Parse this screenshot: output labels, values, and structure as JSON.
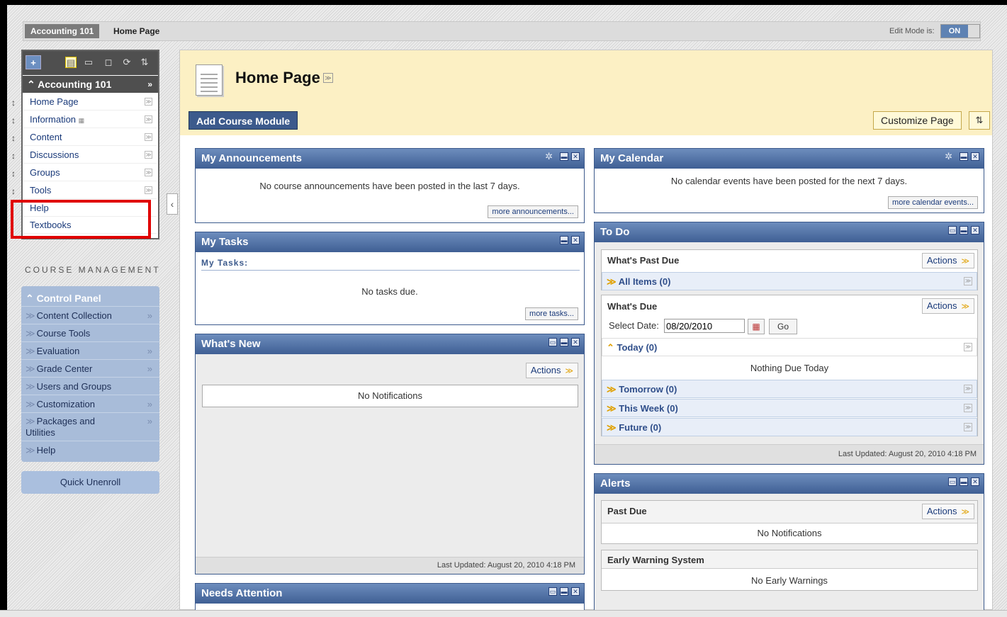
{
  "breadcrumbs": {
    "course": "Accounting 101",
    "page": "Home Page"
  },
  "edit_mode": {
    "label": "Edit Mode is:",
    "value": "ON"
  },
  "course_menu": {
    "title": "Accounting 101",
    "collapse_glyph": "»",
    "items": [
      "Home Page",
      "Information",
      "Content",
      "Discussions",
      "Groups",
      "Tools",
      "Help",
      "Textbooks"
    ],
    "highlight_color": "#e00000"
  },
  "course_management": {
    "heading": "COURSE MANAGEMENT",
    "panel_title": "Control Panel",
    "items": [
      {
        "label": "Content Collection",
        "arrow": "»"
      },
      {
        "label": "Course Tools",
        "arrow": ""
      },
      {
        "label": "Evaluation",
        "arrow": "»"
      },
      {
        "label": "Grade Center",
        "arrow": "»"
      },
      {
        "label": "Users and Groups",
        "arrow": ""
      },
      {
        "label": "Customization",
        "arrow": "»"
      },
      {
        "label": "Packages and Utilities",
        "arrow": "»"
      },
      {
        "label": "Help",
        "arrow": ""
      }
    ],
    "quick_unenroll": "Quick Unenroll"
  },
  "page": {
    "title": "Home Page",
    "add_module": "Add Course Module",
    "customize": "Customize Page"
  },
  "announcements": {
    "title": "My Announcements",
    "message": "No course announcements have been posted in the last 7 days.",
    "more": "more announcements..."
  },
  "tasks": {
    "title": "My Tasks",
    "subtitle": "My Tasks:",
    "message": "No tasks due.",
    "more": "more tasks..."
  },
  "whats_new": {
    "title": "What's New",
    "actions": "Actions",
    "message": "No Notifications",
    "updated": "Last Updated: August 20, 2010 4:18 PM"
  },
  "needs_attention": {
    "title": "Needs Attention"
  },
  "calendar": {
    "title": "My Calendar",
    "message": "No calendar events have been posted for the next 7 days.",
    "more": "more calendar events..."
  },
  "todo": {
    "title": "To Do",
    "past_due": {
      "heading": "What's Past Due",
      "actions": "Actions",
      "all_items": "All Items (0)"
    },
    "due": {
      "heading": "What's Due",
      "actions": "Actions",
      "select_label": "Select Date:",
      "date": "08/20/2010",
      "go": "Go",
      "today": "Today (0)",
      "nothing_today": "Nothing Due Today",
      "tomorrow": "Tomorrow (0)",
      "this_week": "This Week (0)",
      "future": "Future (0)"
    },
    "updated": "Last Updated: August 20, 2010 4:18 PM"
  },
  "alerts": {
    "title": "Alerts",
    "past_due": "Past Due",
    "actions": "Actions",
    "no_notifications": "No Notifications",
    "early_warning": "Early Warning System",
    "no_warnings": "No Early Warnings"
  }
}
